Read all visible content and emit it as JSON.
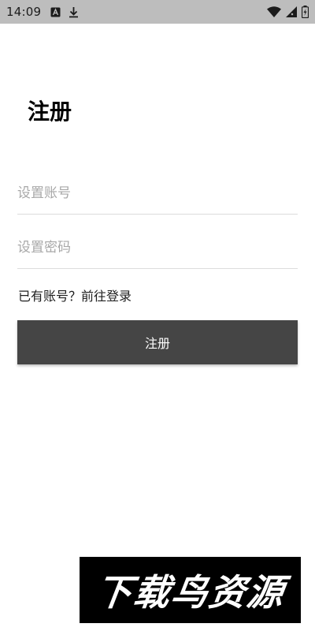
{
  "status_bar": {
    "time": "14:09",
    "left_icons": [
      "a-notification-icon",
      "download-icon"
    ],
    "right_icons": [
      "wifi-icon",
      "cell-signal-icon",
      "battery-charging-icon"
    ]
  },
  "page": {
    "title": "注册"
  },
  "form": {
    "account_placeholder": "设置账号",
    "password_placeholder": "设置密码",
    "login_link": "已有账号？前往登录",
    "register_button": "注册"
  },
  "watermark": {
    "text": "下载鸟资源"
  },
  "colors": {
    "status_bar_bg": "#bdbdbd",
    "button_bg": "#454545",
    "button_text": "#ffffff",
    "placeholder": "#a8a8a8",
    "divider": "#dcdcdc"
  }
}
